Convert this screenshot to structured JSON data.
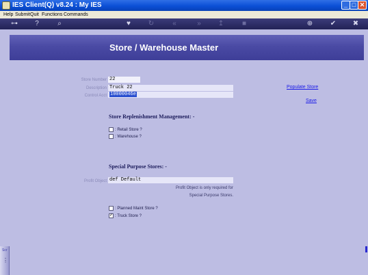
{
  "window": {
    "title": "IES Client(Q) v8.24 : My IES",
    "minimize_glyph": "_",
    "maximize_glyph": "□",
    "close_glyph": "✕"
  },
  "menu": {
    "help": "Help",
    "submit": "Submit",
    "quit": "Quit",
    "functions": "Functions",
    "commands": "Commands"
  },
  "toolbar": {
    "icons": [
      "key-icon",
      "help-icon",
      "search-icon",
      "heart-icon",
      "refresh-icon",
      "back-icon",
      "forward-icon",
      "export-icon",
      "stop-icon",
      "globe-icon",
      "check-icon",
      "close-icon"
    ],
    "glyphs": {
      "key": "⊶",
      "help": "?",
      "search": "⌕",
      "heart": "♥",
      "refresh": "↻",
      "back": "«",
      "forward": "»",
      "export": "↥",
      "stop": "■",
      "globe": "⊕",
      "check": "✔",
      "close": "✖"
    }
  },
  "page": {
    "title": "Store / Warehouse Master"
  },
  "form": {
    "store_number": {
      "label": "Store Number",
      "value": "22"
    },
    "description": {
      "label": "Description",
      "value": "Truck 22"
    },
    "control_acct": {
      "label": "Control Acct",
      "value": "10000046e"
    },
    "profit_object": {
      "label": "Profit Object",
      "value": "def Default"
    }
  },
  "links": {
    "populate_store": "Populate Store",
    "save": "Save"
  },
  "replenishment": {
    "heading": "Store Replenishment Management: -",
    "retail_store": {
      "label": ": Retail Store ?",
      "checked": false
    },
    "warehouse": {
      "label": ": Warehouse ?",
      "checked": false
    }
  },
  "special": {
    "heading": "Special Purpose Stores: -",
    "note_line1": "Profit Object is only required for",
    "note_line2": "Special Purpose Stores.",
    "planned_maint": {
      "label": ": Planned Maint Store ?",
      "checked": false
    },
    "truck_store": {
      "label": ": Truck Store ?",
      "checked": true,
      "mark": "✓"
    }
  },
  "side_tab": {
    "label": "Scr",
    "glyph": "⋮"
  },
  "colors": {
    "accent": "#4a4aa4",
    "background": "#bdbde3",
    "link": "#1a1ae8"
  }
}
